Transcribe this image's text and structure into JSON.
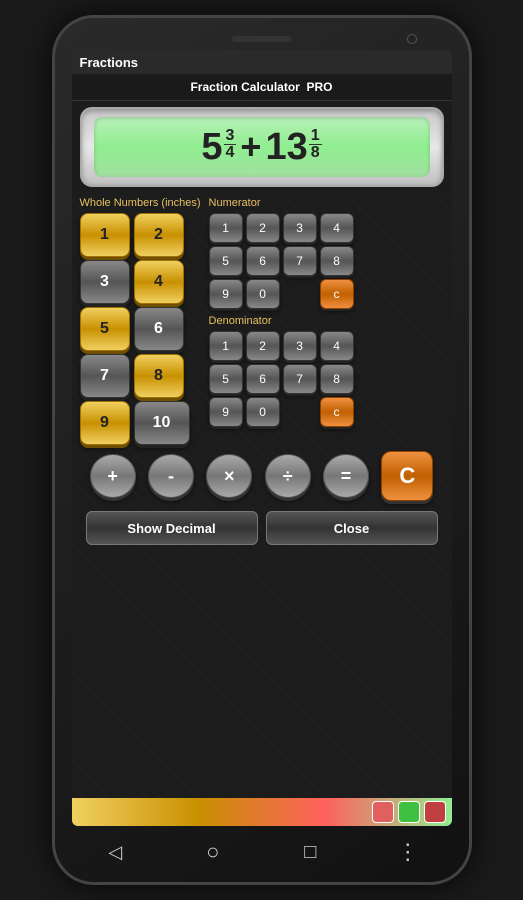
{
  "phone": {
    "status_bar": {
      "title": "Fractions"
    },
    "header": {
      "label": "Fraction Calculator",
      "pro": "PRO"
    },
    "display": {
      "left_whole": "5",
      "left_num": "3",
      "left_den": "4",
      "operator": "+",
      "right_whole": "13",
      "right_num": "1",
      "right_den": "8"
    },
    "whole_numbers": {
      "label": "Whole Numbers  (inches)",
      "buttons": [
        {
          "val": "1",
          "style": "yellow"
        },
        {
          "val": "2",
          "style": "yellow"
        },
        {
          "val": "3",
          "style": "dark"
        },
        {
          "val": "4",
          "style": "yellow"
        },
        {
          "val": "5",
          "style": "yellow"
        },
        {
          "val": "6",
          "style": "dark"
        },
        {
          "val": "7",
          "style": "dark"
        },
        {
          "val": "8",
          "style": "yellow"
        },
        {
          "val": "9",
          "style": "yellow"
        },
        {
          "val": "10",
          "style": "dark"
        }
      ]
    },
    "numerator": {
      "label": "Numerator",
      "buttons": [
        "1",
        "2",
        "3",
        "4",
        "5",
        "6",
        "7",
        "8",
        "9",
        "0",
        "c"
      ]
    },
    "denominator": {
      "label": "Denominator",
      "buttons": [
        "1",
        "2",
        "3",
        "4",
        "5",
        "6",
        "7",
        "8",
        "9",
        "0",
        "c"
      ]
    },
    "operators": [
      "+",
      "-",
      "×",
      "÷",
      "="
    ],
    "clear_label": "C",
    "actions": {
      "show_decimal": "Show Decimal",
      "close": "Close"
    }
  }
}
